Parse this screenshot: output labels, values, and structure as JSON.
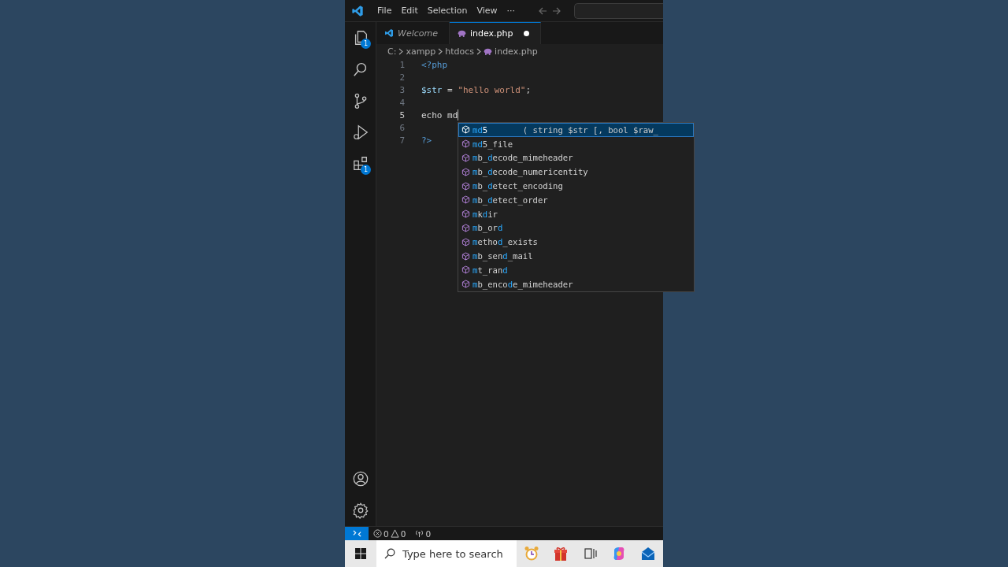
{
  "menu": [
    "File",
    "Edit",
    "Selection",
    "View",
    "···"
  ],
  "activity_bar": [
    {
      "kind": "explorer",
      "badge": "1"
    },
    {
      "kind": "search"
    },
    {
      "kind": "source-control"
    },
    {
      "kind": "run-debug"
    },
    {
      "kind": "extensions",
      "badge": "1"
    }
  ],
  "activity_bar_bottom": [
    {
      "kind": "account"
    },
    {
      "kind": "settings"
    }
  ],
  "tabs": [
    {
      "label": "Welcome",
      "kind": "vscode",
      "selected": false,
      "preview": true,
      "modified": false
    },
    {
      "label": "index.php",
      "kind": "php",
      "selected": true,
      "preview": false,
      "modified": true
    }
  ],
  "breadcrumb": [
    {
      "label": "C:",
      "kind": "folder"
    },
    {
      "label": "xampp",
      "kind": "folder"
    },
    {
      "label": "htdocs",
      "kind": "folder"
    },
    {
      "label": "index.php",
      "kind": "php"
    }
  ],
  "editor": {
    "lines": [
      {
        "number": "1",
        "current": false,
        "tokens": [
          {
            "text": "<?php",
            "kind": "tag"
          }
        ]
      },
      {
        "number": "2",
        "current": false
      },
      {
        "number": "3",
        "current": false,
        "tokens": [
          {
            "text": "$str",
            "kind": "variable"
          },
          {
            "text": " = ",
            "kind": "plain"
          },
          {
            "text": "\"hello world\"",
            "kind": "string"
          },
          {
            "text": ";",
            "kind": "plain"
          }
        ]
      },
      {
        "number": "4",
        "current": false
      },
      {
        "number": "5",
        "current": true,
        "tokens": [
          {
            "text": "echo md",
            "kind": "plain"
          }
        ]
      },
      {
        "number": "6",
        "current": false
      },
      {
        "number": "7",
        "current": false,
        "tokens": [
          {
            "text": "?>",
            "kind": "tag"
          }
        ]
      }
    ]
  },
  "suggestions": [
    {
      "selected": true,
      "detail": "( string $str [, bool $raw_",
      "segments": [
        {
          "text": "md",
          "match": true
        },
        {
          "text": "5",
          "match": false
        }
      ]
    },
    {
      "selected": false,
      "segments": [
        {
          "text": "md",
          "match": true
        },
        {
          "text": "5_file",
          "match": false
        }
      ]
    },
    {
      "selected": false,
      "segments": [
        {
          "text": "m",
          "match": true
        },
        {
          "text": "b_",
          "match": false
        },
        {
          "text": "d",
          "match": true
        },
        {
          "text": "ecode_mimeheader",
          "match": false
        }
      ]
    },
    {
      "selected": false,
      "segments": [
        {
          "text": "m",
          "match": true
        },
        {
          "text": "b_",
          "match": false
        },
        {
          "text": "d",
          "match": true
        },
        {
          "text": "ecode_numericentity",
          "match": false
        }
      ]
    },
    {
      "selected": false,
      "segments": [
        {
          "text": "m",
          "match": true
        },
        {
          "text": "b_",
          "match": false
        },
        {
          "text": "d",
          "match": true
        },
        {
          "text": "etect_encoding",
          "match": false
        }
      ]
    },
    {
      "selected": false,
      "segments": [
        {
          "text": "m",
          "match": true
        },
        {
          "text": "b_",
          "match": false
        },
        {
          "text": "d",
          "match": true
        },
        {
          "text": "etect_order",
          "match": false
        }
      ]
    },
    {
      "selected": false,
      "segments": [
        {
          "text": "m",
          "match": true
        },
        {
          "text": "k",
          "match": false
        },
        {
          "text": "d",
          "match": true
        },
        {
          "text": "ir",
          "match": false
        }
      ]
    },
    {
      "selected": false,
      "segments": [
        {
          "text": "m",
          "match": true
        },
        {
          "text": "b_or",
          "match": false
        },
        {
          "text": "d",
          "match": true
        }
      ]
    },
    {
      "selected": false,
      "segments": [
        {
          "text": "m",
          "match": true
        },
        {
          "text": "etho",
          "match": false
        },
        {
          "text": "d",
          "match": true
        },
        {
          "text": "_exists",
          "match": false
        }
      ]
    },
    {
      "selected": false,
      "segments": [
        {
          "text": "m",
          "match": true
        },
        {
          "text": "b_sen",
          "match": false
        },
        {
          "text": "d",
          "match": true
        },
        {
          "text": "_mail",
          "match": false
        }
      ]
    },
    {
      "selected": false,
      "segments": [
        {
          "text": "m",
          "match": true
        },
        {
          "text": "t_ran",
          "match": false
        },
        {
          "text": "d",
          "match": true
        }
      ]
    },
    {
      "selected": false,
      "segments": [
        {
          "text": "m",
          "match": true
        },
        {
          "text": "b_enco",
          "match": false
        },
        {
          "text": "d",
          "match": true
        },
        {
          "text": "e_mimeheader",
          "match": false
        }
      ]
    }
  ],
  "status_bar": {
    "errors": "0",
    "warnings": "0",
    "ports": "0"
  },
  "taskbar": {
    "search_placeholder": "Type here to search",
    "apps": [
      {
        "kind": "clock"
      },
      {
        "kind": "gift"
      },
      {
        "kind": "task-view"
      },
      {
        "kind": "copilot"
      },
      {
        "kind": "mail"
      }
    ]
  }
}
